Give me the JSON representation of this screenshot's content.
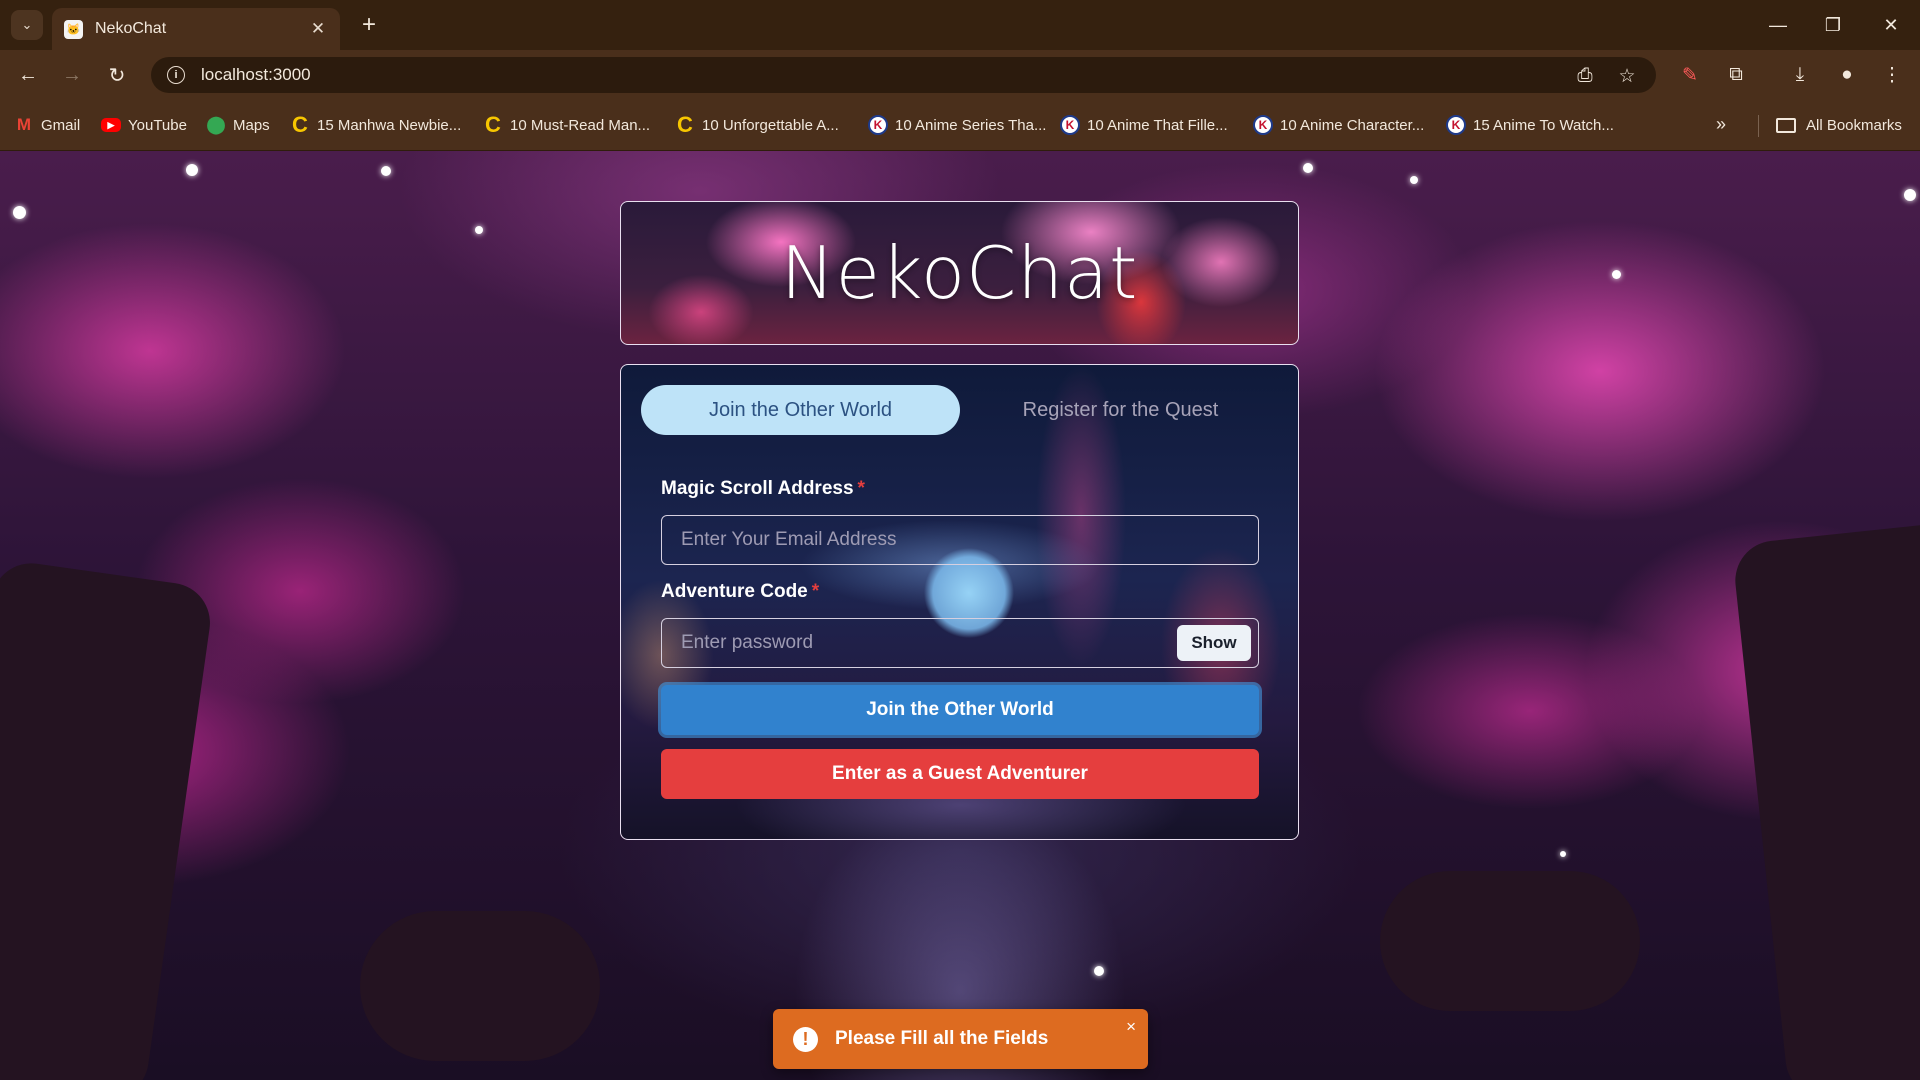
{
  "browser": {
    "tab_title": "NekoChat",
    "address": "localhost:3000",
    "bookmarks": [
      {
        "label": "Gmail",
        "icon": "gmail-icon"
      },
      {
        "label": "YouTube",
        "icon": "youtube-icon"
      },
      {
        "label": "Maps",
        "icon": "maps-icon"
      },
      {
        "label": "15 Manhwa Newbie...",
        "icon": "c-site-icon"
      },
      {
        "label": "10 Must-Read Man...",
        "icon": "c-site-icon"
      },
      {
        "label": "10 Unforgettable A...",
        "icon": "c-site-icon"
      },
      {
        "label": "10 Anime Series Tha...",
        "icon": "k-site-icon"
      },
      {
        "label": "10 Anime That Fille...",
        "icon": "k-site-icon"
      },
      {
        "label": "10 Anime Character...",
        "icon": "k-site-icon"
      },
      {
        "label": "15 Anime To Watch...",
        "icon": "k-site-icon"
      }
    ],
    "all_bookmarks": "All Bookmarks"
  },
  "app": {
    "title": "NekoChat",
    "tabs": {
      "login": "Join the Other World",
      "register": "Register for the Quest"
    },
    "email": {
      "label": "Magic Scroll Address",
      "required": "*",
      "placeholder": "Enter Your Email Address",
      "value": ""
    },
    "password": {
      "label": "Adventure Code",
      "required": "*",
      "placeholder": "Enter password",
      "value": "",
      "toggle": "Show"
    },
    "submit": "Join the Other World",
    "guest": "Enter as a Guest Adventurer"
  },
  "toast": {
    "message": "Please Fill all the Fields",
    "status": "warning",
    "close": "×"
  },
  "colors": {
    "accent_tab": "#bee3f8",
    "primary": "#3182ce",
    "danger": "#e53e3e",
    "toast": "#dd6b20"
  }
}
